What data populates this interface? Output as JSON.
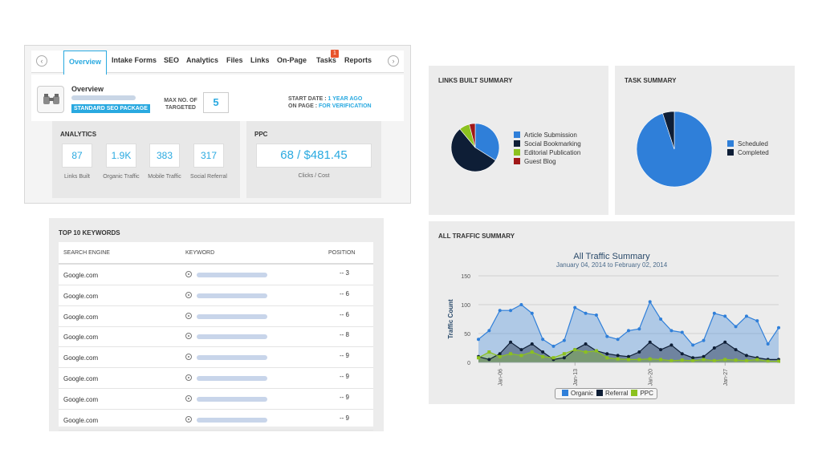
{
  "tabs": {
    "items": [
      {
        "label": "Overview",
        "active": true
      },
      {
        "label": "Intake Forms"
      },
      {
        "label": "SEO"
      },
      {
        "label": "Analytics"
      },
      {
        "label": "Files"
      },
      {
        "label": "Links"
      },
      {
        "label": "On-Page"
      },
      {
        "label": "Tasks"
      },
      {
        "label": "Reports"
      }
    ],
    "tasks_badge": "1"
  },
  "overview": {
    "title": "Overview",
    "package": "STANDARD SEO PACKAGE",
    "max_label": "MAX NO. OF TARGETED",
    "max_value": "5",
    "start_date_label": "START DATE :",
    "start_date_value": "1 YEAR AGO",
    "on_page_label": "ON PAGE :",
    "on_page_value": "FOR VERIFICATION"
  },
  "analytics": {
    "title": "ANALYTICS",
    "stats": [
      {
        "value": "87",
        "label": "Links Built"
      },
      {
        "value": "1.9K",
        "label": "Organic Traffic"
      },
      {
        "value": "383",
        "label": "Mobile Traffic"
      },
      {
        "value": "317",
        "label": "Social Referral"
      }
    ]
  },
  "ppc": {
    "title": "PPC",
    "value": "68 / $481.45",
    "label": "Clicks / Cost"
  },
  "keywords": {
    "title": "TOP 10 KEYWORDS",
    "headers": {
      "engine": "SEARCH ENGINE",
      "keyword": "KEYWORD",
      "position": "POSITION"
    },
    "rows": [
      {
        "engine": "Google.com",
        "position": "-- 3"
      },
      {
        "engine": "Google.com",
        "position": "-- 6"
      },
      {
        "engine": "Google.com",
        "position": "-- 6"
      },
      {
        "engine": "Google.com",
        "position": "-- 8"
      },
      {
        "engine": "Google.com",
        "position": "-- 9"
      },
      {
        "engine": "Google.com",
        "position": "-- 9"
      },
      {
        "engine": "Google.com",
        "position": "-- 9"
      },
      {
        "engine": "Google.com",
        "position": "-- 9"
      }
    ]
  },
  "links_summary": {
    "title": "LINKS BUILT SUMMARY"
  },
  "task_summary": {
    "title": "TASK SUMMARY"
  },
  "traffic_summary": {
    "title": "ALL TRAFFIC SUMMARY"
  },
  "colors": {
    "accent": "#29a9e0",
    "blue": "#2f7fd9",
    "navy": "#0e1e36",
    "green": "#8cc11f",
    "red": "#a01818"
  },
  "chart_data": [
    {
      "type": "pie",
      "title": "",
      "categories": [
        "Article Submission",
        "Social Bookmarking",
        "Editorial Publication",
        "Guest Blog"
      ],
      "values": [
        34,
        55,
        7,
        4
      ],
      "colors": [
        "#2f7fd9",
        "#0e1e36",
        "#8cc11f",
        "#a01818"
      ],
      "legend": "right"
    },
    {
      "type": "pie",
      "title": "",
      "categories": [
        "Scheduled",
        "Completed"
      ],
      "values": [
        95,
        5
      ],
      "colors": [
        "#2f7fd9",
        "#0e1e36"
      ],
      "legend": "right"
    },
    {
      "type": "area",
      "title": "All Traffic Summary",
      "subtitle": "January 04, 2014 to February 02, 2014",
      "ylabel": "Traffic Count",
      "ylim": [
        0,
        150
      ],
      "yticks": [
        "0",
        "50",
        "100",
        "150"
      ],
      "xticks": [
        "Jan-06",
        "Jan-13",
        "Jan-20",
        "Jan-27"
      ],
      "xtick_index": [
        2,
        9,
        16,
        23
      ],
      "grid": true,
      "legend": "bottom",
      "series": [
        {
          "name": "Organic",
          "color": "#2f7fd9",
          "values": [
            40,
            55,
            90,
            90,
            100,
            85,
            40,
            28,
            38,
            95,
            85,
            82,
            45,
            40,
            55,
            58,
            105,
            75,
            55,
            52,
            30,
            38,
            85,
            80,
            62,
            80,
            72,
            32,
            60
          ]
        },
        {
          "name": "Referral",
          "color": "#0e1e36",
          "values": [
            10,
            5,
            15,
            35,
            22,
            32,
            18,
            5,
            8,
            22,
            32,
            20,
            15,
            12,
            10,
            18,
            35,
            22,
            30,
            15,
            8,
            10,
            25,
            35,
            22,
            12,
            8,
            5,
            5
          ]
        },
        {
          "name": "PPC",
          "color": "#8cc11f",
          "values": [
            8,
            18,
            10,
            15,
            12,
            18,
            10,
            8,
            15,
            22,
            18,
            20,
            8,
            6,
            5,
            5,
            6,
            5,
            3,
            4,
            3,
            5,
            3,
            5,
            4,
            3,
            5,
            2,
            2
          ]
        }
      ]
    }
  ]
}
